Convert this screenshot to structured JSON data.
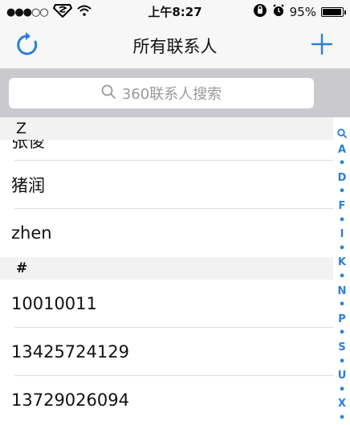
{
  "status_bar": {
    "signal": "●●●○○",
    "time": "上午8:27",
    "battery": "95%"
  },
  "nav": {
    "title": "所有联系人"
  },
  "search": {
    "placeholder": "360联系人搜索"
  },
  "sections": [
    {
      "header": "Z",
      "clipped_item": "张俊",
      "items": [
        "猪润",
        "zhen"
      ]
    },
    {
      "header": "#",
      "items": [
        "10010011",
        "13425724129",
        "13729026094"
      ]
    }
  ],
  "index": [
    "Q",
    "A",
    "•",
    "D",
    "•",
    "F",
    "•",
    "I",
    "•",
    "K",
    "•",
    "N",
    "•",
    "P",
    "•",
    "S",
    "•",
    "U",
    "•",
    "X",
    "•"
  ],
  "colors": {
    "accent": "#2b7fd8",
    "navbar_bg": "#f7f7f7",
    "search_bg": "#c9c9ce",
    "section_bg": "#f2f2f2"
  }
}
